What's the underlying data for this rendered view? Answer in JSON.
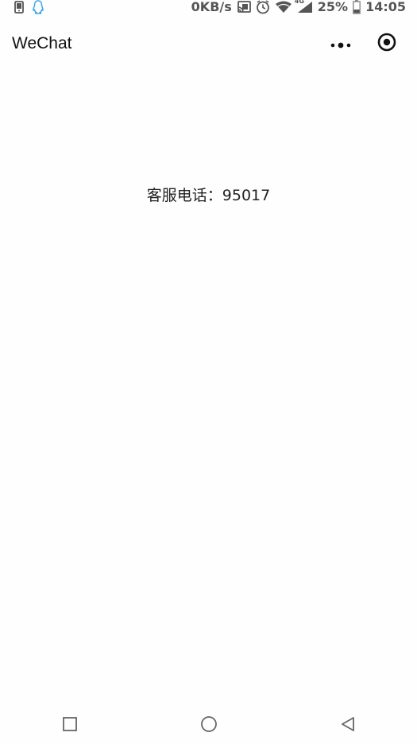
{
  "status_bar": {
    "network_speed": "0KB/s",
    "network_type": "4G",
    "battery": "25%",
    "time": "14:05"
  },
  "header": {
    "title": "WeChat"
  },
  "main": {
    "service_phone": "客服电话：95017"
  },
  "icons": {
    "more": "more-dots-icon",
    "close_miniprogram": "target-circle-icon",
    "nav_recent": "square-icon",
    "nav_home": "circle-icon",
    "nav_back": "triangle-back-icon"
  },
  "colors": {
    "background": "#fefefe",
    "text": "#222222",
    "status": "#555555",
    "qq_blue": "#3aa8e0"
  }
}
